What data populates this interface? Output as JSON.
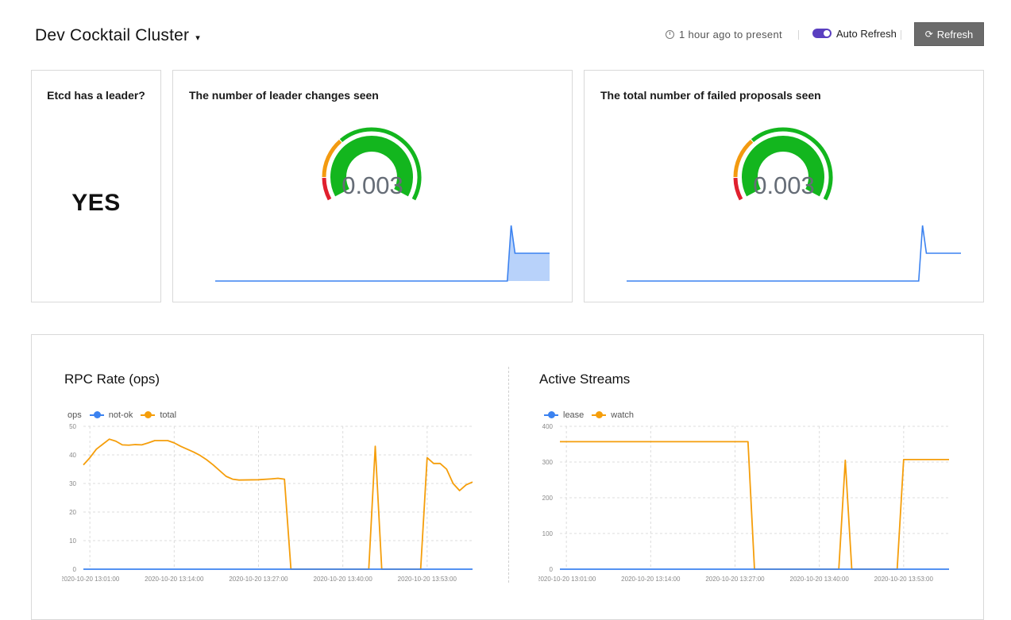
{
  "header": {
    "cluster_name": "Dev Cocktail Cluster",
    "caret": "▾",
    "time_range": "1 hour ago to present",
    "auto_refresh_label": "Auto Refresh",
    "auto_refresh_on": true,
    "refresh_label": "Refresh",
    "refresh_icon": "⟳"
  },
  "leader_panel": {
    "title": "Etcd has a leader?",
    "value": "YES"
  },
  "leader_changes": {
    "title": "The number of leader changes seen",
    "gauge_value": "0.003",
    "sparkline": [
      0,
      0,
      0,
      0,
      0,
      0,
      0,
      0,
      0,
      0,
      0,
      0,
      0,
      0,
      0,
      0,
      0,
      0,
      0,
      0,
      0,
      0,
      0,
      0,
      0,
      0,
      0,
      0,
      0,
      0,
      0,
      0,
      0,
      0,
      0,
      0,
      0,
      0,
      0,
      0,
      0,
      0,
      0,
      0,
      0,
      0,
      0,
      0,
      0,
      0,
      0,
      0,
      0,
      0,
      0,
      0,
      0,
      0,
      0,
      0,
      0,
      0,
      0,
      0,
      0,
      0,
      0,
      0,
      0,
      0,
      0,
      0,
      0,
      0,
      0,
      0,
      0,
      1.0,
      0.5,
      0.5,
      0.5,
      0.5,
      0.5,
      0.5,
      0.5,
      0.5,
      0.5,
      0.5
    ],
    "fill": true
  },
  "failed_proposals": {
    "title": "The total number of failed proposals seen",
    "gauge_value": "0.003",
    "sparkline": [
      0,
      0,
      0,
      0,
      0,
      0,
      0,
      0,
      0,
      0,
      0,
      0,
      0,
      0,
      0,
      0,
      0,
      0,
      0,
      0,
      0,
      0,
      0,
      0,
      0,
      0,
      0,
      0,
      0,
      0,
      0,
      0,
      0,
      0,
      0,
      0,
      0,
      0,
      0,
      0,
      0,
      0,
      0,
      0,
      0,
      0,
      0,
      0,
      0,
      0,
      0,
      0,
      0,
      0,
      0,
      0,
      0,
      0,
      0,
      0,
      0,
      0,
      0,
      0,
      0,
      0,
      0,
      0,
      0,
      0,
      0,
      0,
      0,
      0,
      0,
      0,
      0,
      1.0,
      0.5,
      0.5,
      0.5,
      0.5,
      0.5,
      0.5,
      0.5,
      0.5,
      0.5,
      0.5
    ],
    "fill": false
  },
  "gauge_colors": {
    "red": "#e0202e",
    "orange": "#f39a10",
    "green": "#13b61e",
    "spark_line": "#3b82f0",
    "spark_fill": "#b8d2fa"
  },
  "series_colors": {
    "blue": "#3b82f0",
    "orange": "#f59e0b"
  },
  "chart_data": [
    {
      "type": "line",
      "title": "RPC Rate (ops)",
      "ylabel": "ops",
      "ylim": [
        0,
        50
      ],
      "yticks": [
        0,
        10,
        20,
        30,
        40,
        50
      ],
      "xlim": [
        "2020-10-20 13:00:00",
        "2020-10-20 14:00:00"
      ],
      "xtick_labels": [
        "2020-10-20 13:01:00",
        "2020-10-20 13:14:00",
        "2020-10-20 13:27:00",
        "2020-10-20 13:40:00",
        "2020-10-20 13:53:00"
      ],
      "xtick_values": [
        "2020-10-20 13:01:00",
        "2020-10-20 13:14:00",
        "2020-10-20 13:27:00",
        "2020-10-20 13:40:00",
        "2020-10-20 13:53:00"
      ],
      "series": [
        {
          "name": "not-ok",
          "color": "#3b82f0",
          "points": [
            [
              "2020-10-20 13:00:00",
              0
            ],
            [
              "2020-10-20 14:00:00",
              0
            ]
          ]
        },
        {
          "name": "total",
          "color": "#f59e0b",
          "points": [
            [
              "2020-10-20 13:00:00",
              36.5
            ],
            [
              "2020-10-20 13:01:00",
              39
            ],
            [
              "2020-10-20 13:02:00",
              42
            ],
            [
              "2020-10-20 13:04:00",
              45.5
            ],
            [
              "2020-10-20 13:05:00",
              44.8
            ],
            [
              "2020-10-20 13:06:00",
              43.5
            ],
            [
              "2020-10-20 13:07:00",
              43.4
            ],
            [
              "2020-10-20 13:08:00",
              43.6
            ],
            [
              "2020-10-20 13:09:00",
              43.5
            ],
            [
              "2020-10-20 13:10:00",
              44.2
            ],
            [
              "2020-10-20 13:11:00",
              45.0
            ],
            [
              "2020-10-20 13:13:00",
              45.0
            ],
            [
              "2020-10-20 13:14:00",
              44.2
            ],
            [
              "2020-10-20 13:15:00",
              43
            ],
            [
              "2020-10-20 13:17:00",
              41
            ],
            [
              "2020-10-20 13:18:00",
              39.8
            ],
            [
              "2020-10-20 13:19:00",
              38.3
            ],
            [
              "2020-10-20 13:20:00",
              36.5
            ],
            [
              "2020-10-20 13:22:00",
              32.5
            ],
            [
              "2020-10-20 13:23:00",
              31.5
            ],
            [
              "2020-10-20 13:24:00",
              31.2
            ],
            [
              "2020-10-20 13:27:00",
              31.3
            ],
            [
              "2020-10-20 13:29:00",
              31.6
            ],
            [
              "2020-10-20 13:30:00",
              31.8
            ],
            [
              "2020-10-20 13:31:00",
              31.5
            ],
            [
              "2020-10-20 13:32:00",
              0
            ],
            [
              "2020-10-20 13:44:00",
              0
            ],
            [
              "2020-10-20 13:45:00",
              43
            ],
            [
              "2020-10-20 13:46:00",
              0
            ],
            [
              "2020-10-20 13:52:00",
              0
            ],
            [
              "2020-10-20 13:53:00",
              39
            ],
            [
              "2020-10-20 13:54:00",
              37
            ],
            [
              "2020-10-20 13:55:00",
              37
            ],
            [
              "2020-10-20 13:56:00",
              35
            ],
            [
              "2020-10-20 13:57:00",
              30
            ],
            [
              "2020-10-20 13:58:00",
              27.5
            ],
            [
              "2020-10-20 13:59:00",
              29.5
            ],
            [
              "2020-10-20 14:00:00",
              30.5
            ]
          ]
        }
      ],
      "grid": true,
      "legend_position": "top-left"
    },
    {
      "type": "line",
      "title": "Active Streams",
      "ylabel": "",
      "ylim": [
        0,
        400
      ],
      "yticks": [
        0,
        100,
        200,
        300,
        400
      ],
      "xlim": [
        "2020-10-20 13:00:00",
        "2020-10-20 14:00:00"
      ],
      "xtick_labels": [
        "2020-10-20 13:01:00",
        "2020-10-20 13:14:00",
        "2020-10-20 13:27:00",
        "2020-10-20 13:40:00",
        "2020-10-20 13:53:00"
      ],
      "xtick_values": [
        "2020-10-20 13:01:00",
        "2020-10-20 13:14:00",
        "2020-10-20 13:27:00",
        "2020-10-20 13:40:00",
        "2020-10-20 13:53:00"
      ],
      "series": [
        {
          "name": "lease",
          "color": "#3b82f0",
          "points": [
            [
              "2020-10-20 13:00:00",
              0
            ],
            [
              "2020-10-20 14:00:00",
              0
            ]
          ]
        },
        {
          "name": "watch",
          "color": "#f59e0b",
          "points": [
            [
              "2020-10-20 13:00:00",
              357
            ],
            [
              "2020-10-20 13:29:00",
              357
            ],
            [
              "2020-10-20 13:30:00",
              0
            ],
            [
              "2020-10-20 13:43:00",
              0
            ],
            [
              "2020-10-20 13:44:00",
              305
            ],
            [
              "2020-10-20 13:45:00",
              0
            ],
            [
              "2020-10-20 13:52:00",
              0
            ],
            [
              "2020-10-20 13:53:00",
              307
            ],
            [
              "2020-10-20 14:00:00",
              307
            ]
          ]
        }
      ],
      "grid": true,
      "legend_position": "top-left"
    }
  ]
}
